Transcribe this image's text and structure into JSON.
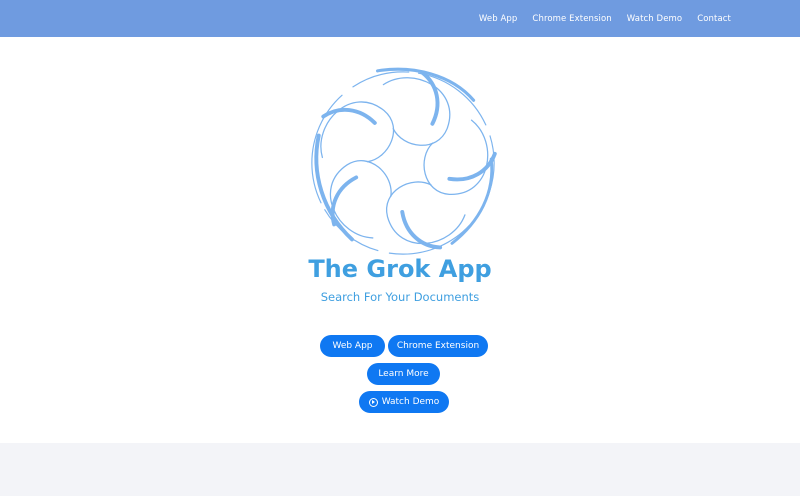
{
  "nav": {
    "items": [
      {
        "label": "Web App"
      },
      {
        "label": "Chrome Extension"
      },
      {
        "label": "Watch Demo"
      },
      {
        "label": "Contact"
      }
    ]
  },
  "hero": {
    "logo_icon": "swirl-logo-icon",
    "title": "The Grok App",
    "subtitle": "Search For Your Documents",
    "buttons": {
      "web_app": "Web App",
      "chrome_extension": "Chrome Extension",
      "learn_more": "Learn More",
      "watch_demo": "Watch Demo"
    }
  },
  "colors": {
    "topbar": "#6f9be0",
    "accent": "#3f9fe0",
    "button": "#0f78f2",
    "footer": "#f3f4f8"
  }
}
